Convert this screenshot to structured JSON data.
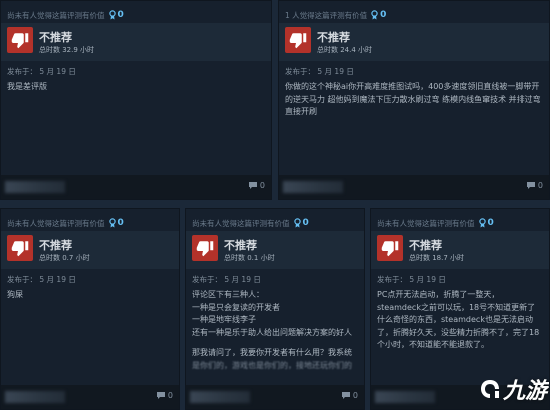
{
  "reviews": [
    {
      "helpful_text": "尚未有人觉得这篇评测有价值",
      "award_count": "0",
      "recommendation": "不推荐",
      "hours": "总时数 32.9 小时",
      "posted": "发布于：  5 月 19 日",
      "lines": [
        "我是差评版"
      ],
      "comment_count": "0"
    },
    {
      "helpful_text": "1 人觉得这篇评测有价值",
      "award_count": "0",
      "recommendation": "不推荐",
      "hours": "总时数 24.4 小时",
      "posted": "发布于：  5 月 19 日",
      "lines": [
        "你做的这个神秘ai你开高难度推图试吗，400多速度领旧直线被一脚带开的逆天马力 超他妈到魔法下压力散水刷过弯 练模内线鱼窜技术 并排过弯直接开刷"
      ],
      "comment_count": "0"
    },
    {
      "helpful_text": "尚未有人觉得这篇评测有价值",
      "award_count": "0",
      "recommendation": "不推荐",
      "hours": "总时数 0.7 小时",
      "posted": "发布于：  5 月 19 日",
      "lines": [
        "狗屎"
      ],
      "comment_count": "0"
    },
    {
      "helpful_text": "尚未有人觉得这篇评测有价值",
      "award_count": "0",
      "recommendation": "不推荐",
      "hours": "总时数 0.1 小时",
      "posted": "发布于：  5 月 19 日",
      "lines": [
        "评论区下有三种人：",
        "一种是只会复读的开发者",
        "一种是地牢线李子",
        "还有一种是乐于助人给出问题解决方案的好人",
        "",
        "那我请问了，我要你开发者有什么用？我系统",
        "是你们的，游戏也是你们的，接地还玩你们的"
      ],
      "comment_count": "0"
    },
    {
      "helpful_text": "尚未有人觉得这篇评测有价值",
      "award_count": "0",
      "recommendation": "不推荐",
      "hours": "总时数 18.7 小时",
      "posted": "发布于：  5 月 19 日",
      "lines": [
        "PC点开无法启动，折腾了一整天，steamdeck之前可以玩，18号不知道更新了什么奇怪的东西，steamdeck也是无法启动了，折腾好久天，没些精力折腾不了，完了18个小时，不知道能不能退款了。"
      ],
      "comment_count": "0"
    }
  ],
  "watermark": {
    "text": "九游"
  },
  "colors": {
    "thumb_down": "#b3322a",
    "award": "#66c0f4",
    "background": "#1b2838"
  }
}
